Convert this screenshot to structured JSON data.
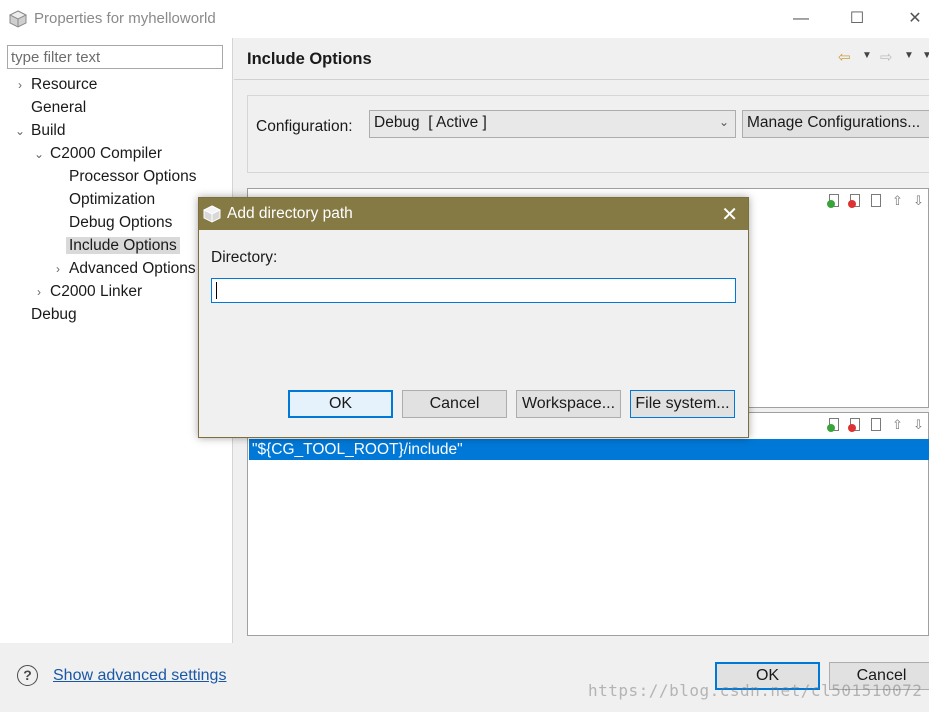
{
  "window": {
    "title": "Properties for myhelloworld",
    "minimize_icon": "minimize-icon",
    "maximize_icon": "maximize-icon",
    "close_icon": "close-icon"
  },
  "sidebar": {
    "filter_placeholder": "type filter text",
    "items": [
      {
        "label": "Resource",
        "expanded": false
      },
      {
        "label": "General"
      },
      {
        "label": "Build",
        "expanded": true
      },
      {
        "label": "C2000 Compiler",
        "expanded": true
      },
      {
        "label": "Processor Options"
      },
      {
        "label": "Optimization"
      },
      {
        "label": "Debug Options"
      },
      {
        "label": "Include Options",
        "selected": true
      },
      {
        "label": "Advanced Options",
        "expanded": false
      },
      {
        "label": "C2000 Linker",
        "expanded": false
      },
      {
        "label": "Debug"
      }
    ]
  },
  "page": {
    "title": "Include Options",
    "configuration_label": "Configuration:",
    "configuration_value": "Debug  [ Active ]",
    "manage_button": "Manage Configurations...",
    "lower_list": {
      "rows": [
        "\"${CG_TOOL_ROOT}/include\""
      ]
    }
  },
  "dialog": {
    "title": "Add directory path",
    "directory_label": "Directory:",
    "directory_value": "",
    "ok": "OK",
    "cancel": "Cancel",
    "workspace": "Workspace...",
    "file_system": "File system..."
  },
  "footer": {
    "help_icon": "help-icon",
    "advanced_link": "Show advanced settings",
    "ok": "OK",
    "cancel": "Cancel",
    "watermark": "https://blog.csdn.net/cl501510072"
  },
  "colors": {
    "dialog_titlebar": "#857a44",
    "selection": "#0078d7",
    "link": "#1a57a6"
  }
}
